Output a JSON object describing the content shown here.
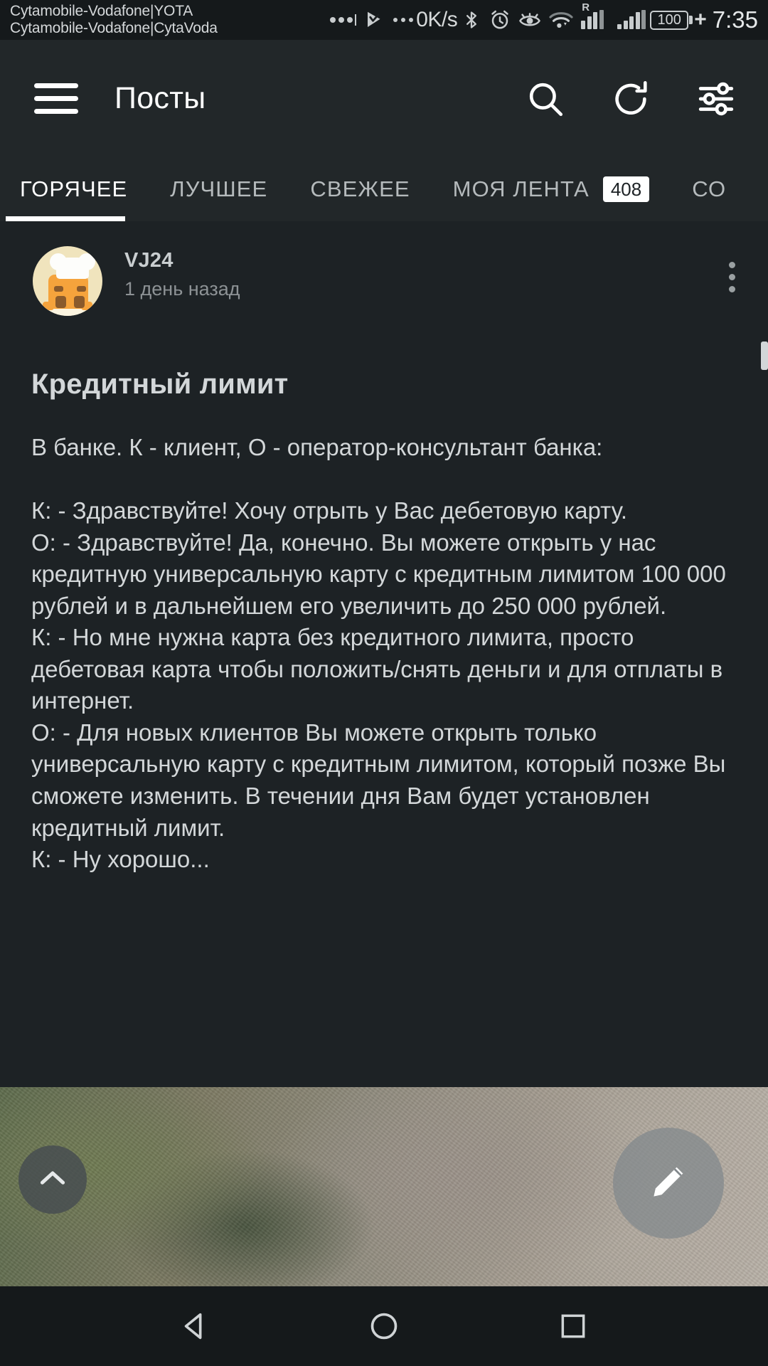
{
  "statusbar": {
    "carrier_line1": "Cytamobile-Vodafone|YOTA",
    "carrier_line2": "Cytamobile-Vodafone|CytaVoda",
    "net_speed": "0K/s",
    "battery_level": "100",
    "charging_symbol": "+",
    "time": "7:35",
    "roaming_label": "R",
    "icons": [
      "dots-menu-icon",
      "play-check-icon",
      "more-dots-icon",
      "bluetooth-icon",
      "alarm-icon",
      "eye-icon",
      "wifi-icon",
      "signal-roaming-icon",
      "signal-icon",
      "battery-icon"
    ]
  },
  "appbar": {
    "title": "Посты",
    "menu_icon": "hamburger-menu-icon",
    "search_icon": "search-icon",
    "refresh_icon": "refresh-icon",
    "filter_icon": "filter-settings-icon"
  },
  "tabs": [
    {
      "label": "ГОРЯЧЕЕ",
      "active": true,
      "badge": null
    },
    {
      "label": "ЛУЧШЕЕ",
      "active": false,
      "badge": null
    },
    {
      "label": "СВЕЖЕЕ",
      "active": false,
      "badge": null
    },
    {
      "label": "МОЯ ЛЕНТА",
      "active": false,
      "badge": "408"
    },
    {
      "label": "СО",
      "active": false,
      "badge": null
    }
  ],
  "post": {
    "author": "VJ24",
    "time_ago": "1 день назад",
    "title": "Кредитный лимит",
    "body": "В банке. К - клиент, О - оператор-консультант банка:\n\nК: - Здравствуйте! Хочу отрыть у Вас дебетовую карту.\nО: - Здравствуйте! Да, конечно. Вы можете открыть у нас кредитную универсальную карту с кредитным лимитом 100 000 рублей и в дальнейшем его увеличить до 250 000 рублей.\nК: - Но мне нужна карта без кредитного лимита, просто дебетовая карта чтобы положить/снять деньги и для отплаты в интернет.\nО: - Для новых клиентов Вы можете открыть только универсальную карту с кредитным лимитом, который позже Вы сможете изменить. В течении дня Вам будет установлен кредитный лимит.\nК: - Ну хорошо...",
    "avatar_name": "chef-avatar",
    "menu_icon": "kebab-menu-icon"
  },
  "fab": {
    "scroll_up_icon": "chevron-up-icon",
    "compose_icon": "pencil-edit-icon"
  },
  "navbar": {
    "back_icon": "back-triangle-icon",
    "home_icon": "home-circle-icon",
    "recents_icon": "recents-square-icon"
  },
  "colors": {
    "status_bg": "#15191b",
    "appbar_bg": "#222729",
    "page_bg": "#1d2225",
    "accent": "#ffffff",
    "text_primary": "#d3d7d9",
    "text_secondary": "#8d9295"
  }
}
